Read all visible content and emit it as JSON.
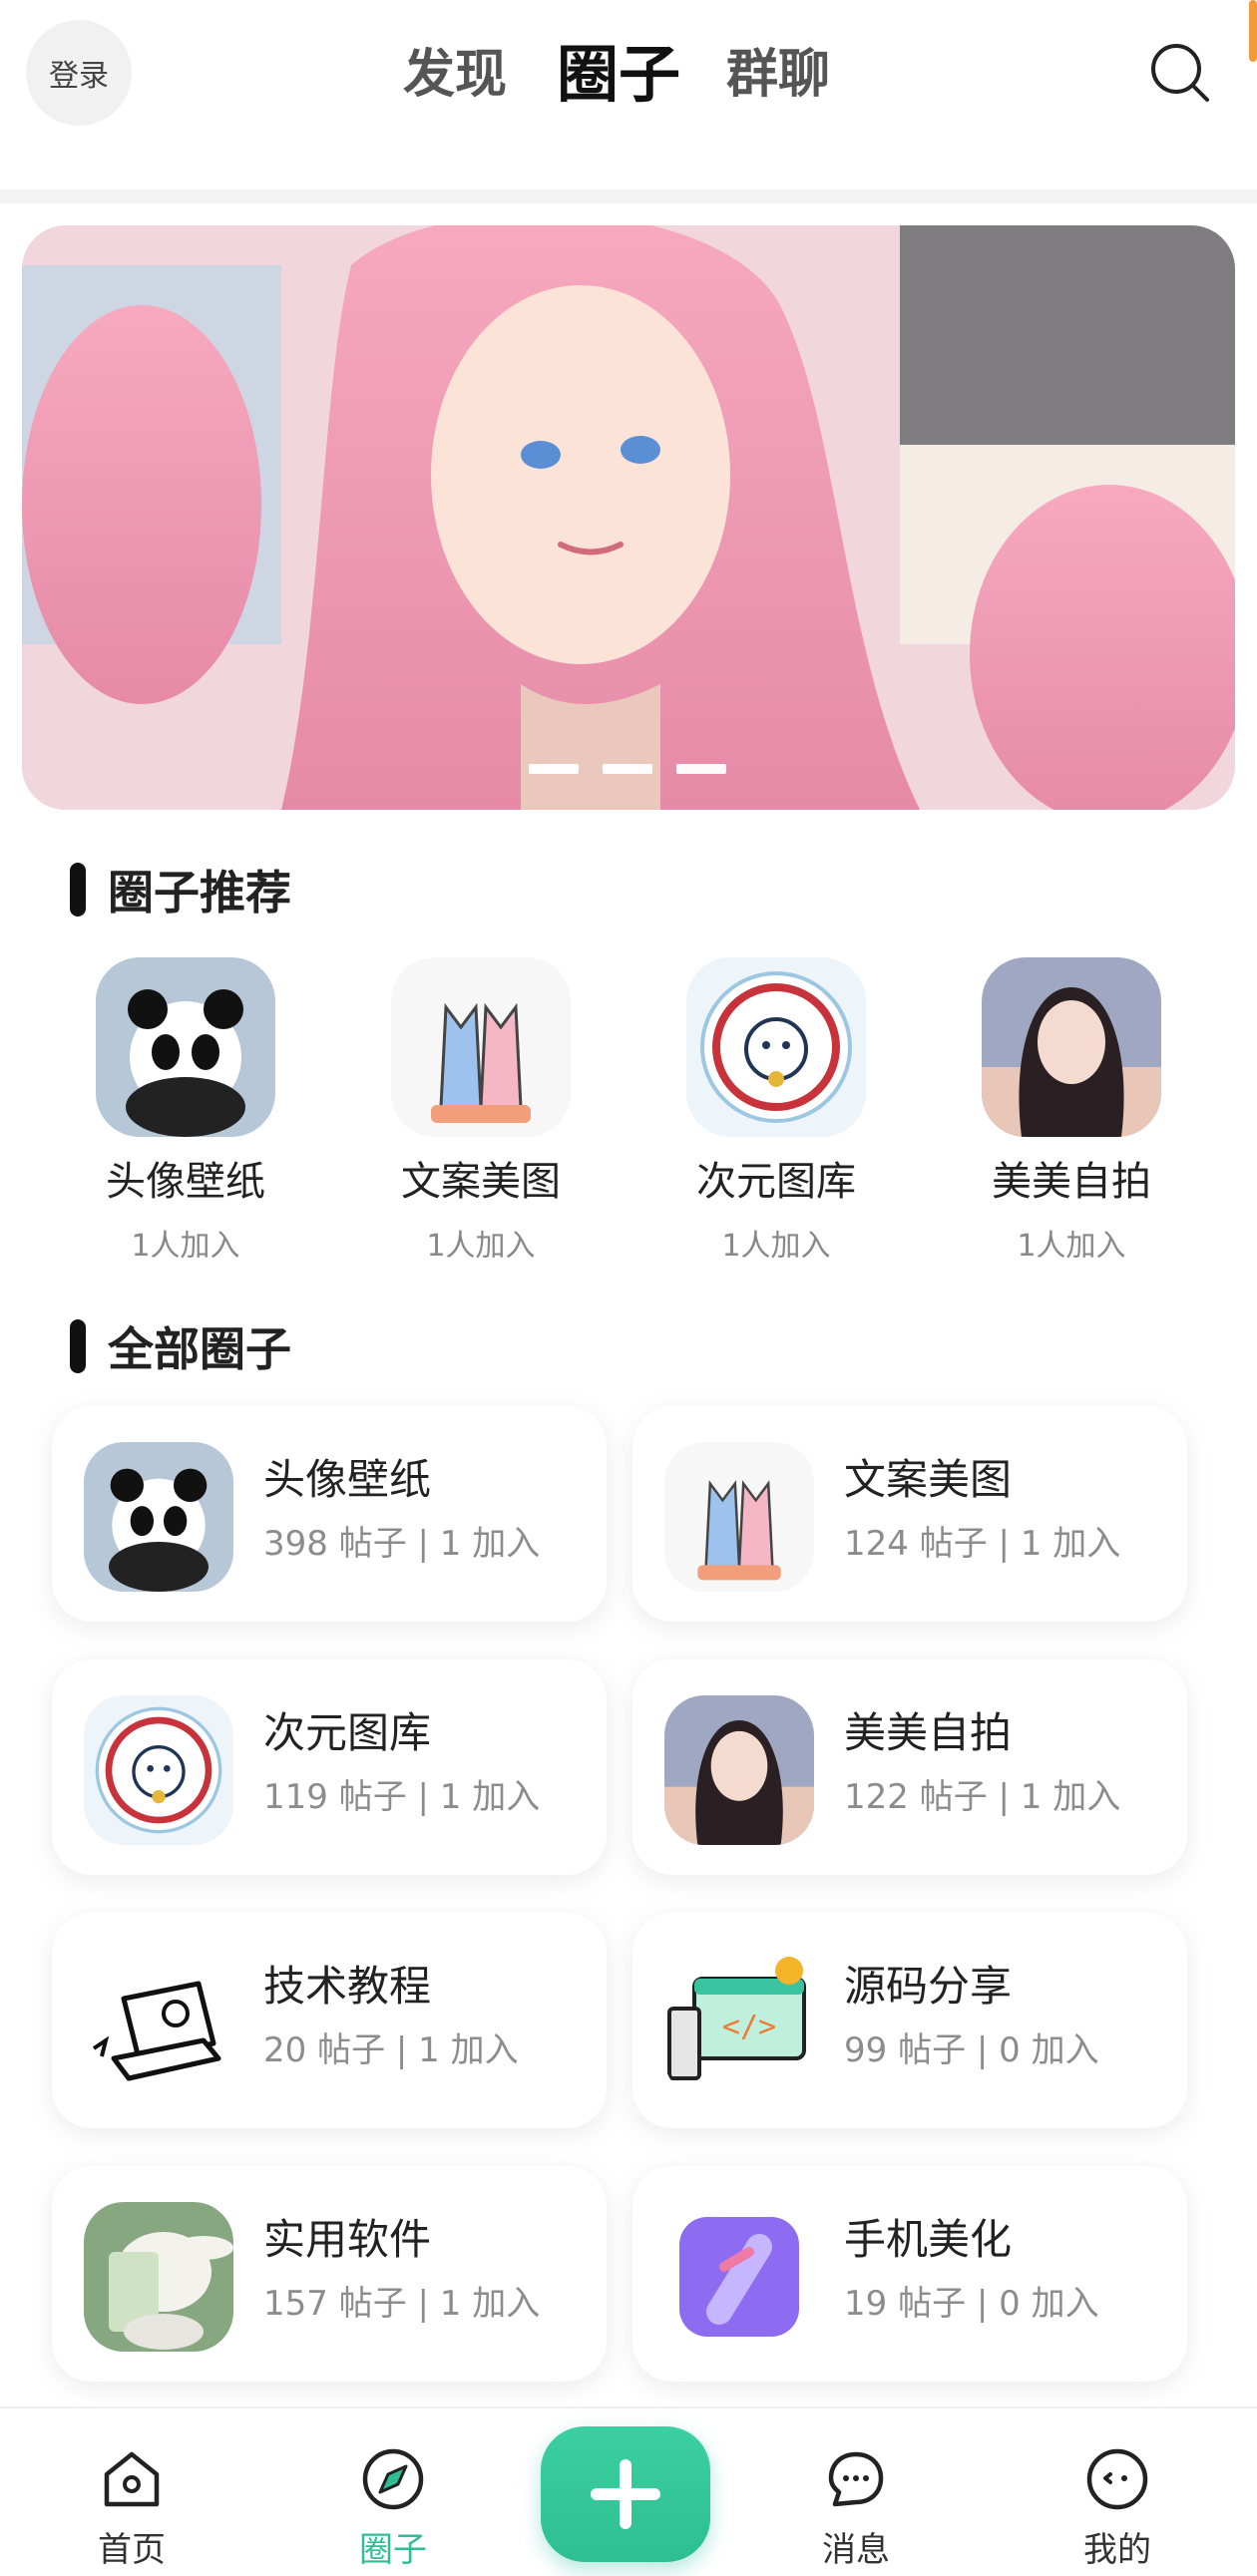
{
  "header": {
    "login_label": "登录",
    "tabs": [
      {
        "label": "发现",
        "active": false
      },
      {
        "label": "圈子",
        "active": true
      },
      {
        "label": "群聊",
        "active": false
      }
    ]
  },
  "banner": {
    "dots": 3,
    "active_dot": 1
  },
  "recommended": {
    "title": "圈子推荐",
    "items": [
      {
        "name": "头像壁纸",
        "count": "1人加入",
        "icon": "panda-icon"
      },
      {
        "name": "文案美图",
        "count": "1人加入",
        "icon": "cats-logo-icon"
      },
      {
        "name": "次元图库",
        "count": "1人加入",
        "icon": "cat-badge-icon"
      },
      {
        "name": "美美自拍",
        "count": "1人加入",
        "icon": "girl-portrait-icon"
      }
    ]
  },
  "all_circles": {
    "title": "全部圈子",
    "items": [
      {
        "name": "头像壁纸",
        "meta": "398 帖子 | 1 加入",
        "icon": "panda-icon"
      },
      {
        "name": "文案美图",
        "meta": "124 帖子 | 1 加入",
        "icon": "cats-logo-icon"
      },
      {
        "name": "次元图库",
        "meta": "119 帖子 | 1 加入",
        "icon": "cat-badge-icon"
      },
      {
        "name": "美美自拍",
        "meta": "122 帖子 | 1 加入",
        "icon": "girl-portrait-icon"
      },
      {
        "name": "技术教程",
        "meta": "20 帖子 | 1 加入",
        "icon": "laptop-icon"
      },
      {
        "name": "源码分享",
        "meta": "99 帖子 | 0 加入",
        "icon": "code-monitor-icon"
      },
      {
        "name": "实用软件",
        "meta": "157 帖子 | 1 加入",
        "icon": "bunny-icon"
      },
      {
        "name": "手机美化",
        "meta": "19 帖子 | 0 加入",
        "icon": "purple-link-icon"
      }
    ]
  },
  "bottom_nav": {
    "items": [
      {
        "label": "首页",
        "icon": "home-icon",
        "active": false
      },
      {
        "label": "圈子",
        "icon": "compass-icon",
        "active": true
      },
      {
        "label": "消息",
        "icon": "chat-icon",
        "active": false
      },
      {
        "label": "我的",
        "icon": "face-icon",
        "active": false
      }
    ]
  },
  "colors": {
    "accent": "#2fbd95",
    "orange_edge": "#f39a3a",
    "text_primary": "#222222",
    "text_secondary": "#8c8c8c"
  }
}
